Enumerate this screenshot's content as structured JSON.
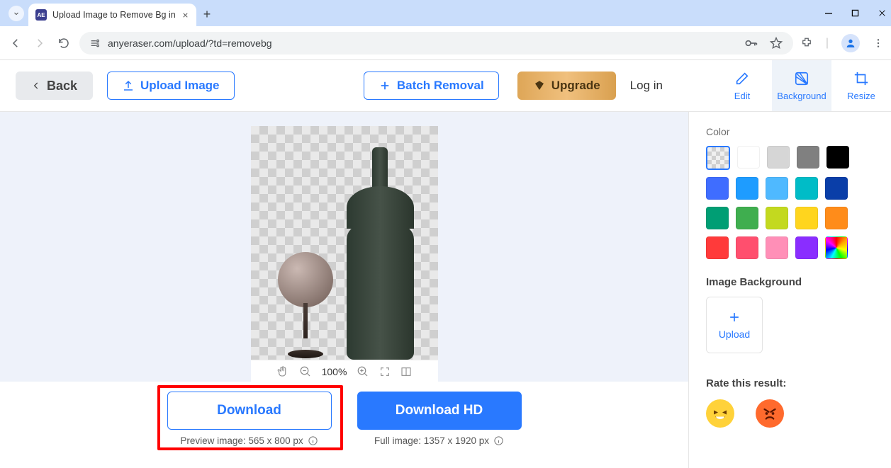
{
  "browser": {
    "tab_title": "Upload Image to Remove Bg in",
    "favicon_text": "AE",
    "url": "anyeraser.com/upload/?td=removebg"
  },
  "toolbar": {
    "back_label": "Back",
    "upload_label": "Upload Image",
    "batch_label": "Batch Removal",
    "upgrade_label": "Upgrade",
    "login_label": "Log in",
    "tabs": {
      "edit": "Edit",
      "background": "Background",
      "resize": "Resize"
    }
  },
  "zoom": {
    "percent": "100%"
  },
  "download": {
    "standard_label": "Download",
    "hd_label": "Download HD",
    "preview_meta": "Preview image: 565 x 800 px",
    "full_meta": "Full image: 1357 x 1920 px"
  },
  "side": {
    "color_label": "Color",
    "image_bg_label": "Image Background",
    "upload_label": "Upload",
    "rate_label": "Rate this result:",
    "colors": [
      "transparent",
      "#ffffff",
      "#d6d6d6",
      "#808080",
      "#000000",
      "#3f6dff",
      "#1e9cff",
      "#4fb9ff",
      "#00bcc7",
      "#0a3ea8",
      "#009e74",
      "#3fae4f",
      "#c3d91f",
      "#ffd51e",
      "#ff8c1a",
      "#ff3a3a",
      "#ff4f6e",
      "#ff8fb7",
      "#8a2dff",
      "rainbow"
    ]
  }
}
